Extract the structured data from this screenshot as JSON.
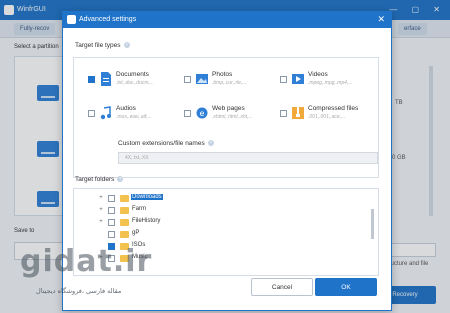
{
  "app": {
    "title": "WinfrGUI",
    "window_controls": "— ▢ ✕"
  },
  "background": {
    "tabs": [
      "Fully-recov",
      "erface"
    ],
    "select_partition_label": "Select a partition",
    "save_to_label": "Save to",
    "right_texts": [
      "TB",
      "0 GB",
      "structure and file"
    ],
    "recovery_button": "Recovery"
  },
  "dialog": {
    "title": "Advanced settings",
    "close_glyph": "✕",
    "target_file_types_label": "Target file types",
    "file_types": [
      {
        "name": "Documents",
        "ext": ".txt,.doc,.docm,...",
        "checked": true,
        "icon": "document-icon",
        "color": "#2f7fd6"
      },
      {
        "name": "Photos",
        "ext": ".bmp,.cur,.rle,...",
        "checked": false,
        "icon": "photo-icon",
        "color": "#2f7fd6"
      },
      {
        "name": "Videos",
        "ext": ".mpeg,.mpg,.mp4,...",
        "checked": false,
        "icon": "video-icon",
        "color": "#2f7fd6"
      },
      {
        "name": "Audios",
        "ext": ".mus,.wav,.aif,...",
        "checked": false,
        "icon": "audio-icon",
        "color": "#2f7fd6"
      },
      {
        "name": "Web pages",
        "ext": ".xhtml,.html,.xht,...",
        "checked": false,
        "icon": "web-page-icon",
        "color": "#2f7fd6"
      },
      {
        "name": "Compressed files",
        "ext": ".001,.001,.ace,...",
        "checked": false,
        "icon": "compressed-file-icon",
        "color": "#f2a93b"
      }
    ],
    "custom_label": "Custom extensions/file names",
    "custom_placeholder": "4X, txt,.XX",
    "target_folders_label": "Target folders",
    "folders": [
      {
        "name": "Downloads",
        "checked": false,
        "selected": true
      },
      {
        "name": "Farm",
        "checked": false,
        "selected": false
      },
      {
        "name": "FileHistory",
        "checked": false,
        "selected": false
      },
      {
        "name": "gP",
        "checked": false,
        "selected": false
      },
      {
        "name": "ISOs",
        "checked": true,
        "selected": false
      },
      {
        "name": "Music",
        "checked": false,
        "selected": false
      }
    ],
    "cancel_label": "Cancel",
    "ok_label": "OK"
  },
  "watermark": {
    "logo": "gidat.ir",
    "subtitle": "مقاله فارسی ،فروشگاه دیجیتال"
  }
}
